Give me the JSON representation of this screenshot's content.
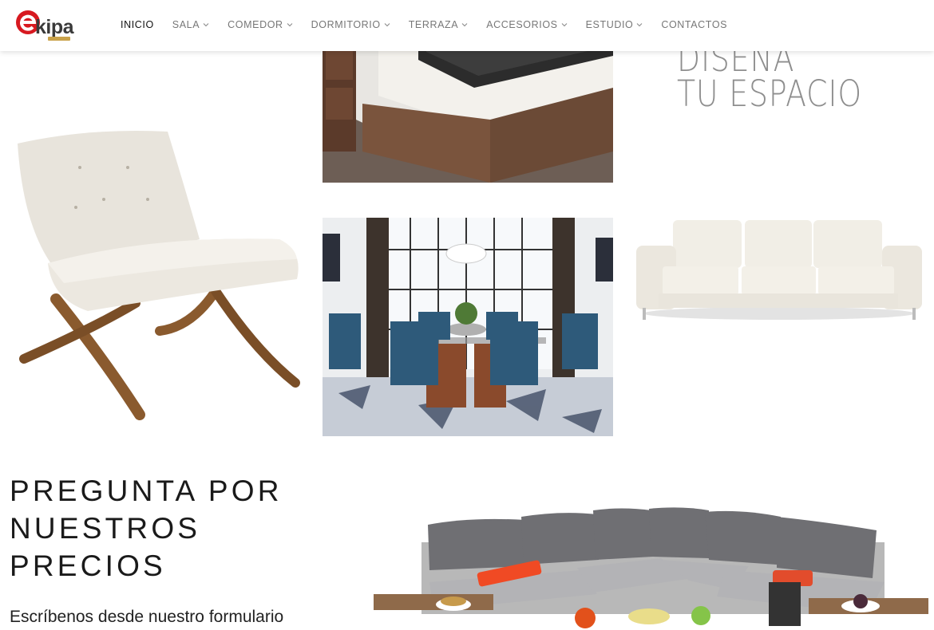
{
  "brand": {
    "name": "kipa",
    "accent": "#d71920",
    "tag_color": "#c9a24a"
  },
  "nav": [
    {
      "label": "INICIO",
      "dropdown": false,
      "active": true
    },
    {
      "label": "SALA",
      "dropdown": true
    },
    {
      "label": "COMEDOR",
      "dropdown": true
    },
    {
      "label": "DORMITORIO",
      "dropdown": true
    },
    {
      "label": "TERRAZA",
      "dropdown": true
    },
    {
      "label": "ACCESORIOS",
      "dropdown": true
    },
    {
      "label": "ESTUDIO",
      "dropdown": true
    },
    {
      "label": "CONTACTOS",
      "dropdown": false
    }
  ],
  "hero": {
    "slogan_line1": "DISEÑA",
    "slogan_line2": "TU ESPACIO"
  },
  "cta": {
    "line1": "PREGUNTA POR",
    "line2": "NUESTROS",
    "line3": "PRECIOS",
    "subtitle": "Escríbenos desde nuestro formulario"
  },
  "icons": {
    "chevron": "chevron-down-icon"
  }
}
